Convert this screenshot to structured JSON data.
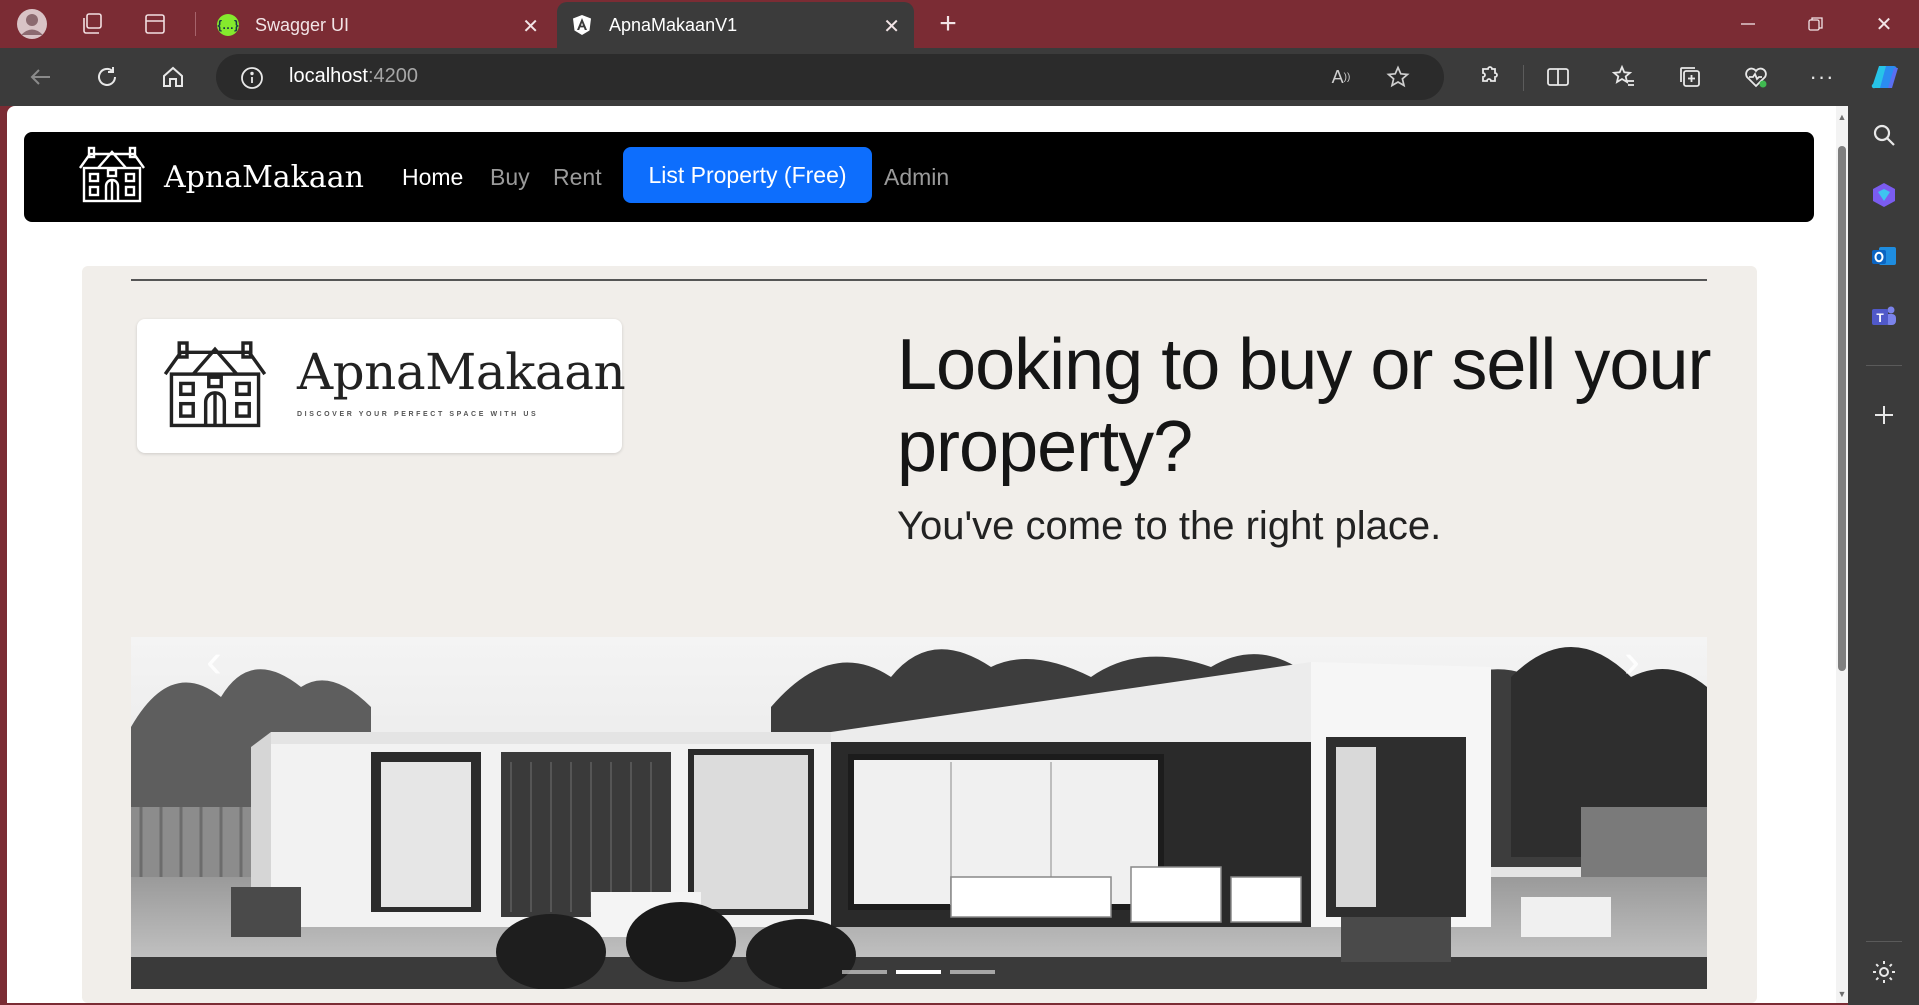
{
  "browser": {
    "tabs": [
      {
        "title": "Swagger UI",
        "favicon": "swagger-icon",
        "favicon_color": "#85ea2d",
        "active": false
      },
      {
        "title": "ApnaMakaanV1",
        "favicon": "angular-icon",
        "favicon_color": "#ffffff",
        "active": true
      }
    ],
    "address": {
      "host": "localhost",
      "port": ":4200"
    },
    "frame_color": "#7b2c34",
    "toolbar_color": "#3b3b3b"
  },
  "navbar": {
    "brand": "ApnaMakaan",
    "links": [
      {
        "label": "Home",
        "active": true
      },
      {
        "label": "Buy",
        "active": false
      },
      {
        "label": "Rent",
        "active": false
      }
    ],
    "cta_label": "List Property (Free)",
    "admin_label": "Admin",
    "cta_color": "#0d6efd"
  },
  "hero": {
    "logo_title": "ApnaMakaan",
    "logo_tagline": "DISCOVER YOUR PERFECT SPACE WITH US",
    "heading": "Looking to buy or sell your property?",
    "subheading": "You've come to the right place.",
    "slide_count": 3,
    "active_slide": 1
  }
}
